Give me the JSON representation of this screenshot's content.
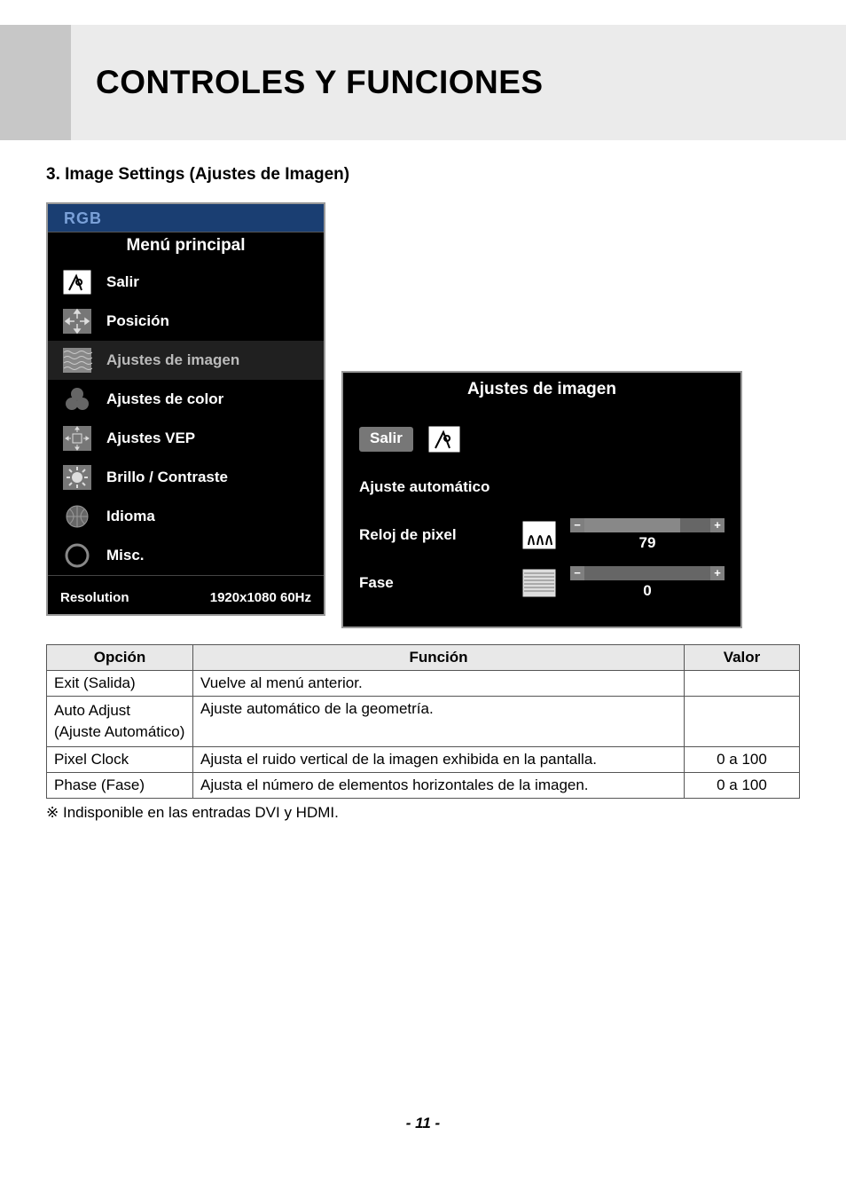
{
  "header": {
    "title": "CONTROLES Y FUNCIONES"
  },
  "section": {
    "heading": "3. Image Settings (Ajustes de Imagen)"
  },
  "main_panel": {
    "rgb": "RGB",
    "title": "Menú principal",
    "items": [
      {
        "label": "Salir"
      },
      {
        "label": "Posición"
      },
      {
        "label": "Ajustes de imagen"
      },
      {
        "label": "Ajustes de color"
      },
      {
        "label": "Ajustes VEP"
      },
      {
        "label": "Brillo / Contraste"
      },
      {
        "label": "Idioma"
      },
      {
        "label": "Misc."
      }
    ],
    "res_label": "Resolution",
    "res_value": "1920x1080 60Hz"
  },
  "sub_panel": {
    "title": "Ajustes de imagen",
    "exit": "Salir",
    "rows": [
      {
        "label": "Ajuste automático"
      },
      {
        "label": "Reloj de pixel",
        "value": "79"
      },
      {
        "label": "Fase",
        "value": "0"
      }
    ]
  },
  "table": {
    "headers": {
      "opt": "Opción",
      "fn": "Función",
      "val": "Valor"
    },
    "rows": [
      {
        "opt": "Exit (Salida)",
        "fn": "Vuelve al menú anterior.",
        "val": ""
      },
      {
        "opt": "Auto Adjust\n(Ajuste Automático)",
        "fn": "Ajuste automático de la geometría.",
        "val": ""
      },
      {
        "opt": "Pixel Clock",
        "fn": "Ajusta el ruido vertical de la imagen exhibida en la pantalla.",
        "val": "0 a 100"
      },
      {
        "opt": "Phase (Fase)",
        "fn": "Ajusta el número de elementos horizontales de la imagen.",
        "val": "0 a 100"
      }
    ]
  },
  "note": "※ Indisponible en las entradas DVI y HDMI.",
  "page": "- 11 -"
}
